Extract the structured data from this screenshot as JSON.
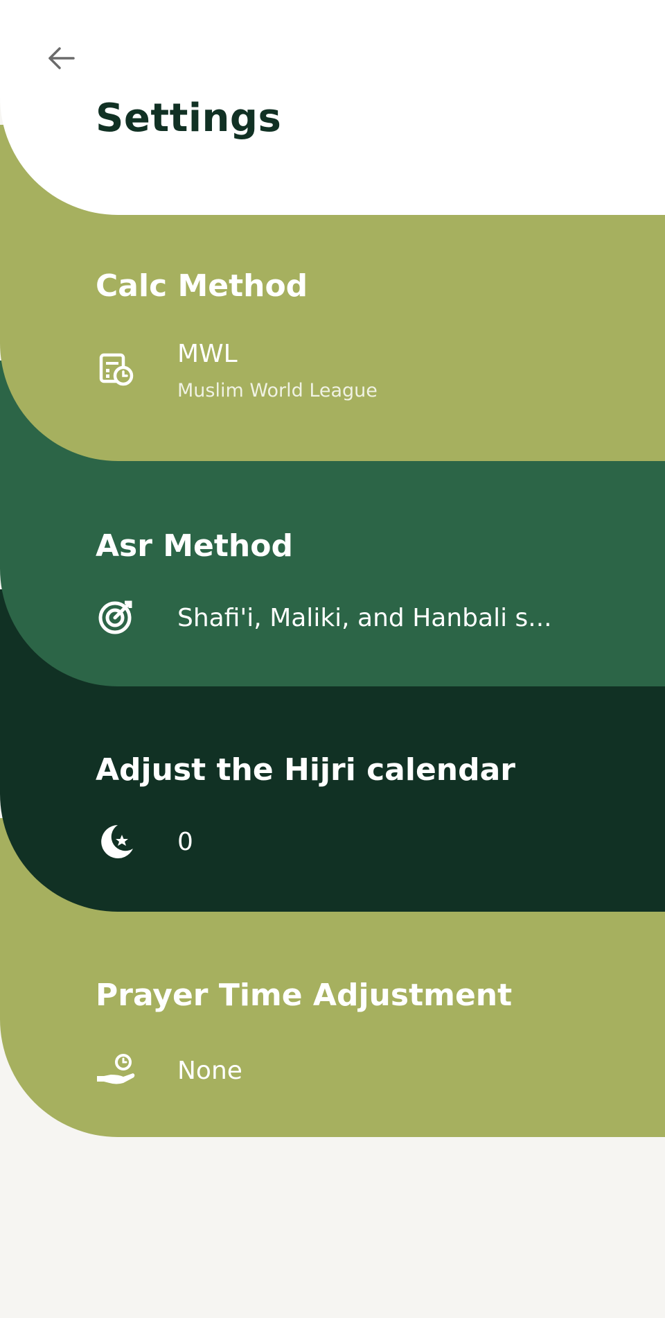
{
  "header": {
    "title": "Settings",
    "back_icon": "arrow-left-icon"
  },
  "colors": {
    "header_bg": "#ffffff",
    "olive": "#a6b05f",
    "green": "#2c6547",
    "dark_green": "#113124",
    "page_bg": "#f6f5f2"
  },
  "sections": {
    "calc": {
      "title": "Calc Method",
      "value": "MWL",
      "subvalue": "Muslim World League",
      "icon": "calendar-clock-icon"
    },
    "asr": {
      "title": "Asr Method",
      "value": "Shafi'i, Maliki, and Hanbali s...",
      "icon": "target-icon"
    },
    "hijri": {
      "title": "Adjust the Hijri calendar",
      "value": "0",
      "icon": "crescent-star-icon"
    },
    "prayer": {
      "title": "Prayer Time Adjustment",
      "value": "None",
      "icon": "hand-clock-icon"
    }
  }
}
